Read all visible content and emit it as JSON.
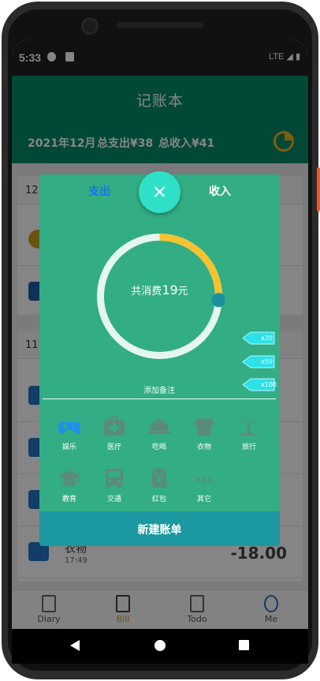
{
  "status": {
    "time": "5:33",
    "network": "LTE"
  },
  "app": {
    "title": "记账本"
  },
  "summary": {
    "month": "2021年12月",
    "expense": "总支出¥38",
    "income": "总收入¥41"
  },
  "list": {
    "group1_date": "12",
    "group2_date": "11",
    "last_item": {
      "name": "衣物",
      "time": "17:49",
      "amount": "-18.00"
    }
  },
  "tabs": [
    {
      "label": "Diary"
    },
    {
      "label": "Bill"
    },
    {
      "label": "Todo"
    },
    {
      "label": "Me"
    }
  ],
  "dialog": {
    "tab_expense": "支出",
    "tab_income": "收入",
    "ring_prefix": "共消费",
    "ring_amount": "19",
    "ring_suffix": "元",
    "ring_progress": 0.26,
    "tags": [
      "x20",
      "x50",
      "x100"
    ],
    "memo_placeholder": "添加备注",
    "categories": [
      {
        "label": "娱乐",
        "icon": "gamepad-icon",
        "color": "#1f8ef1"
      },
      {
        "label": "医疗",
        "icon": "medical-kit-icon",
        "color": "#5b8a7a"
      },
      {
        "label": "吃喝",
        "icon": "food-cloche-icon",
        "color": "#5b8a7a"
      },
      {
        "label": "衣物",
        "icon": "shirt-icon",
        "color": "#5b8a7a"
      },
      {
        "label": "旅行",
        "icon": "palm-tree-icon",
        "color": "#5b8a7a"
      },
      {
        "label": "教育",
        "icon": "graduation-cap-icon",
        "color": "#5b8a7a"
      },
      {
        "label": "交通",
        "icon": "bus-icon",
        "color": "#5b8a7a"
      },
      {
        "label": "红包",
        "icon": "red-envelope-icon",
        "color": "#5b8a7a"
      },
      {
        "label": "其它",
        "icon": "more-dots-icon",
        "color": "#5b8a7a"
      }
    ],
    "submit_label": "新建账单"
  },
  "colors": {
    "accent_green": "#058a68",
    "dialog_green": "#33ad84",
    "ring_progress": "#f5c330",
    "close_button": "#2ee0c5"
  }
}
